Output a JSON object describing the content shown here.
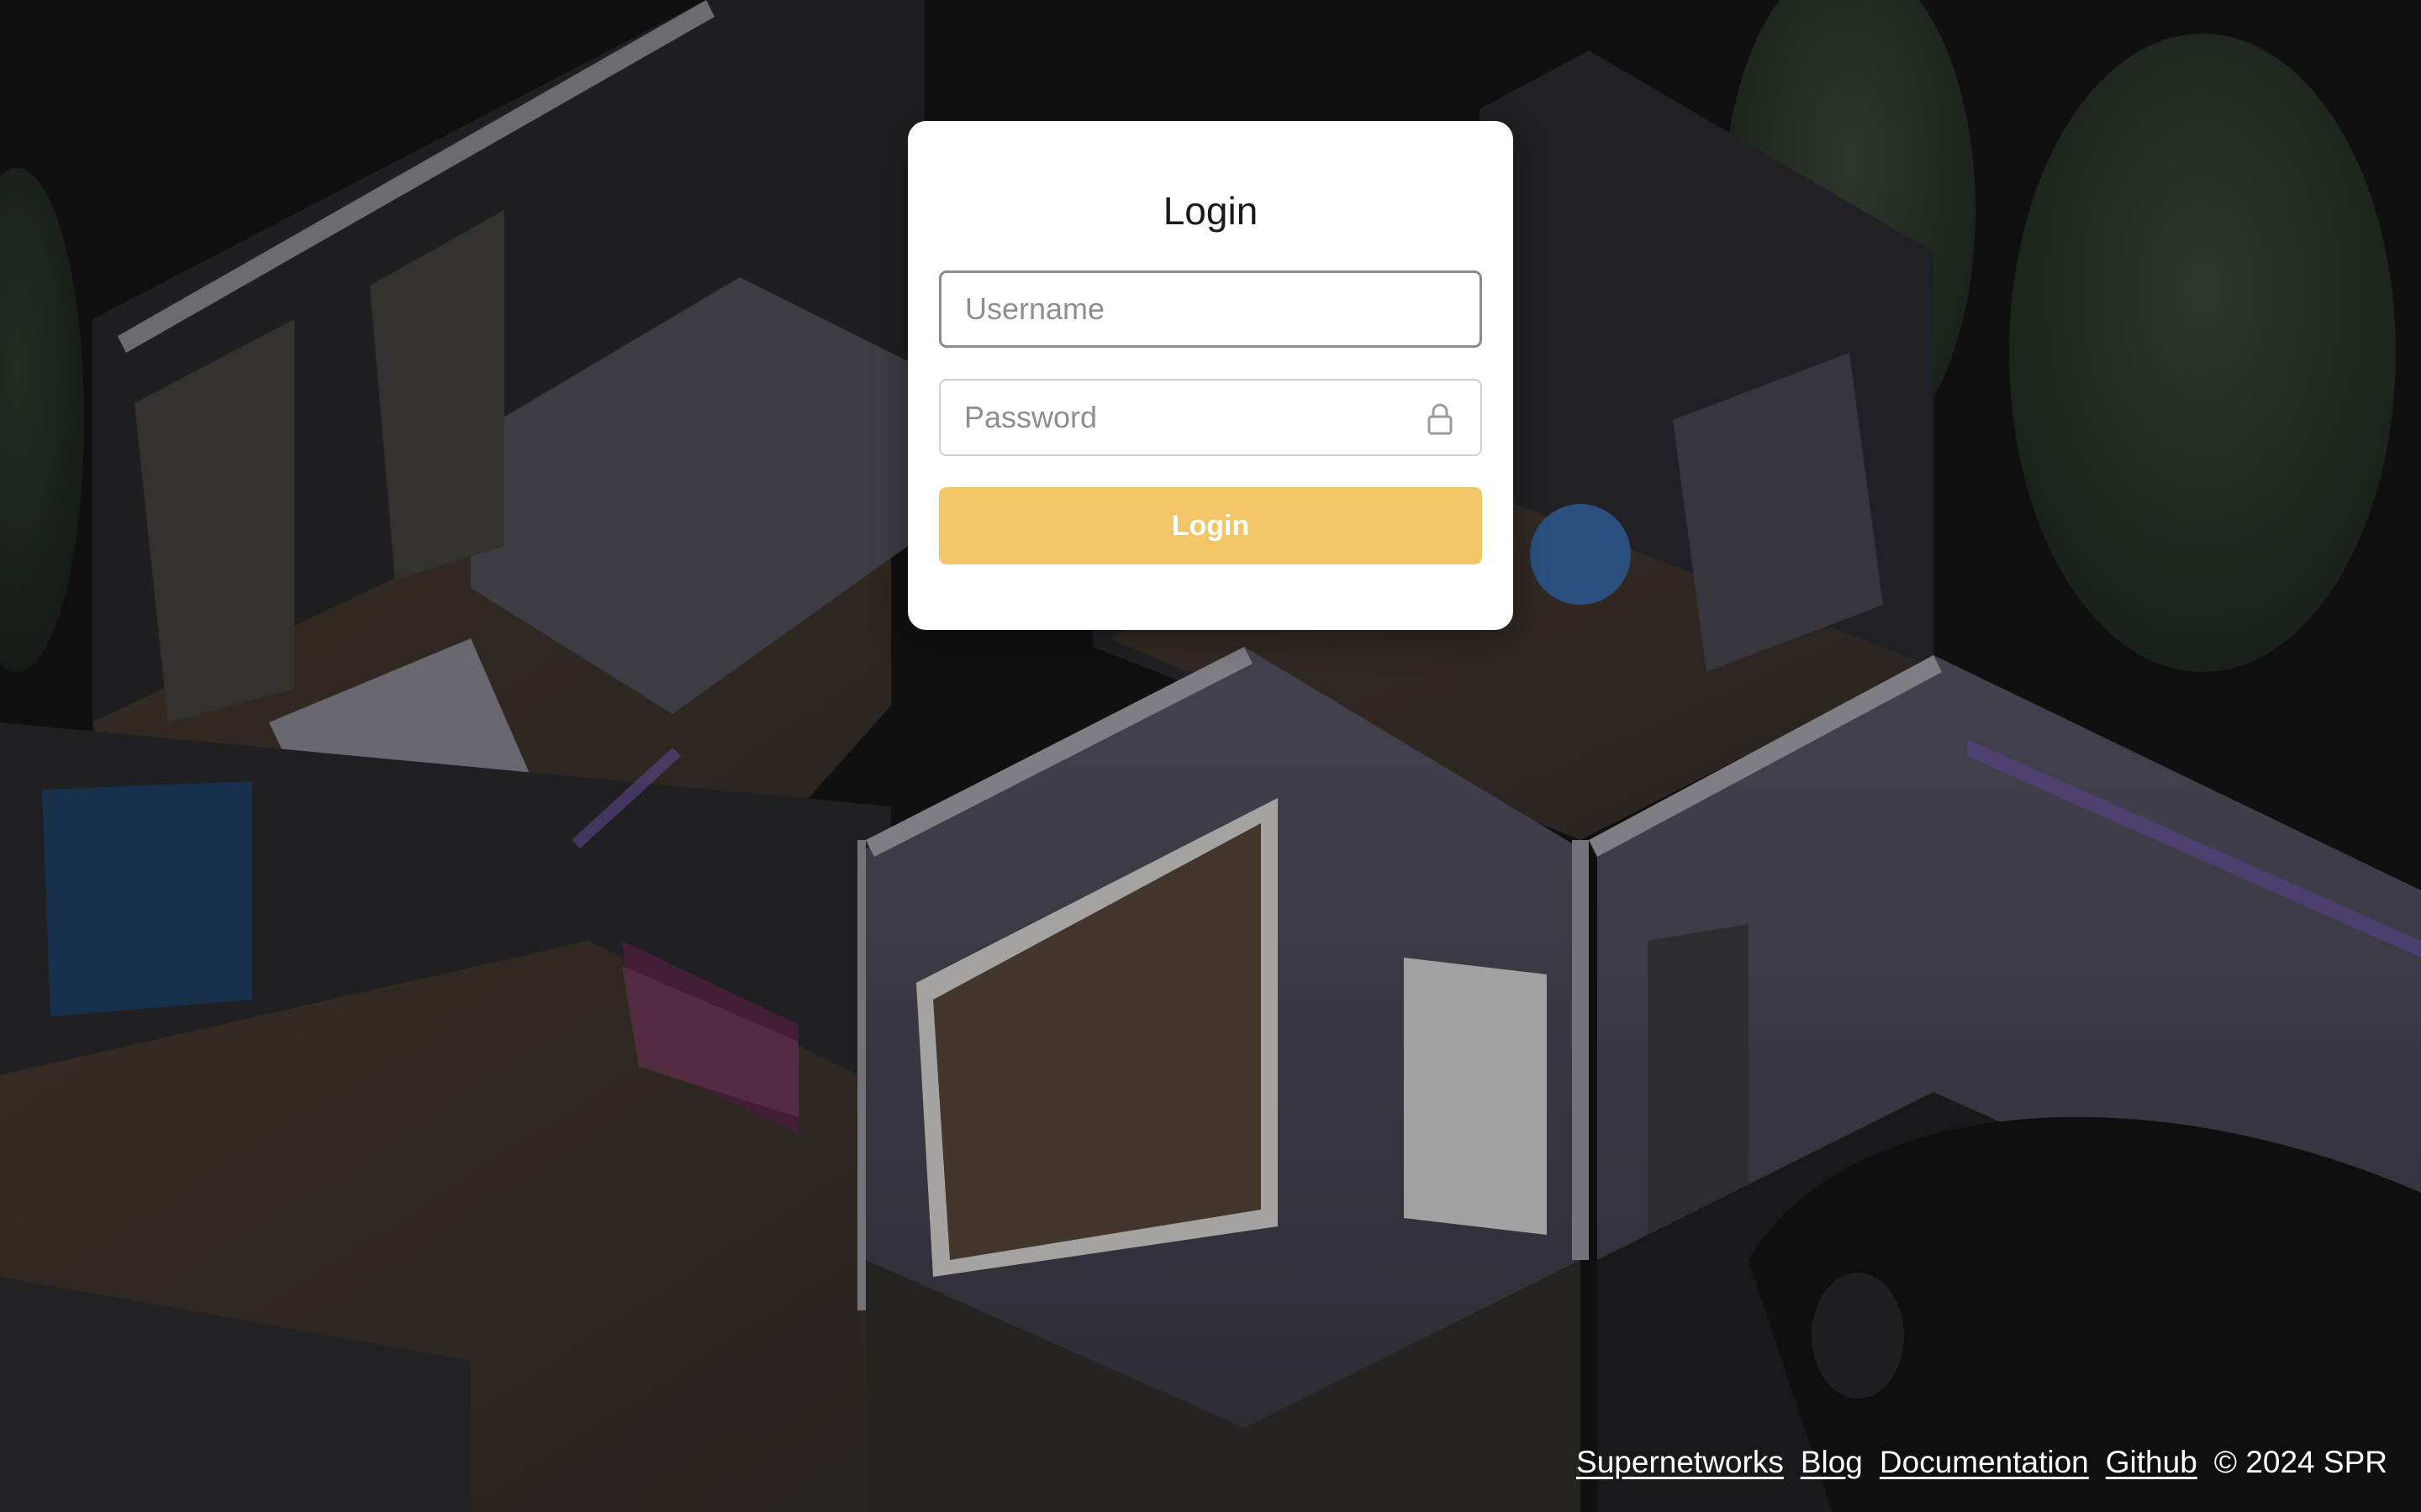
{
  "login": {
    "title": "Login",
    "username_placeholder": "Username",
    "password_placeholder": "Password",
    "submit_label": "Login"
  },
  "footer": {
    "links": [
      "Supernetworks",
      "Blog",
      "Documentation",
      "Github"
    ],
    "copyright": "© 2024 SPR"
  },
  "colors": {
    "button": "#f2c666",
    "background": "#161616"
  },
  "icons": {
    "password": "lock-icon"
  }
}
